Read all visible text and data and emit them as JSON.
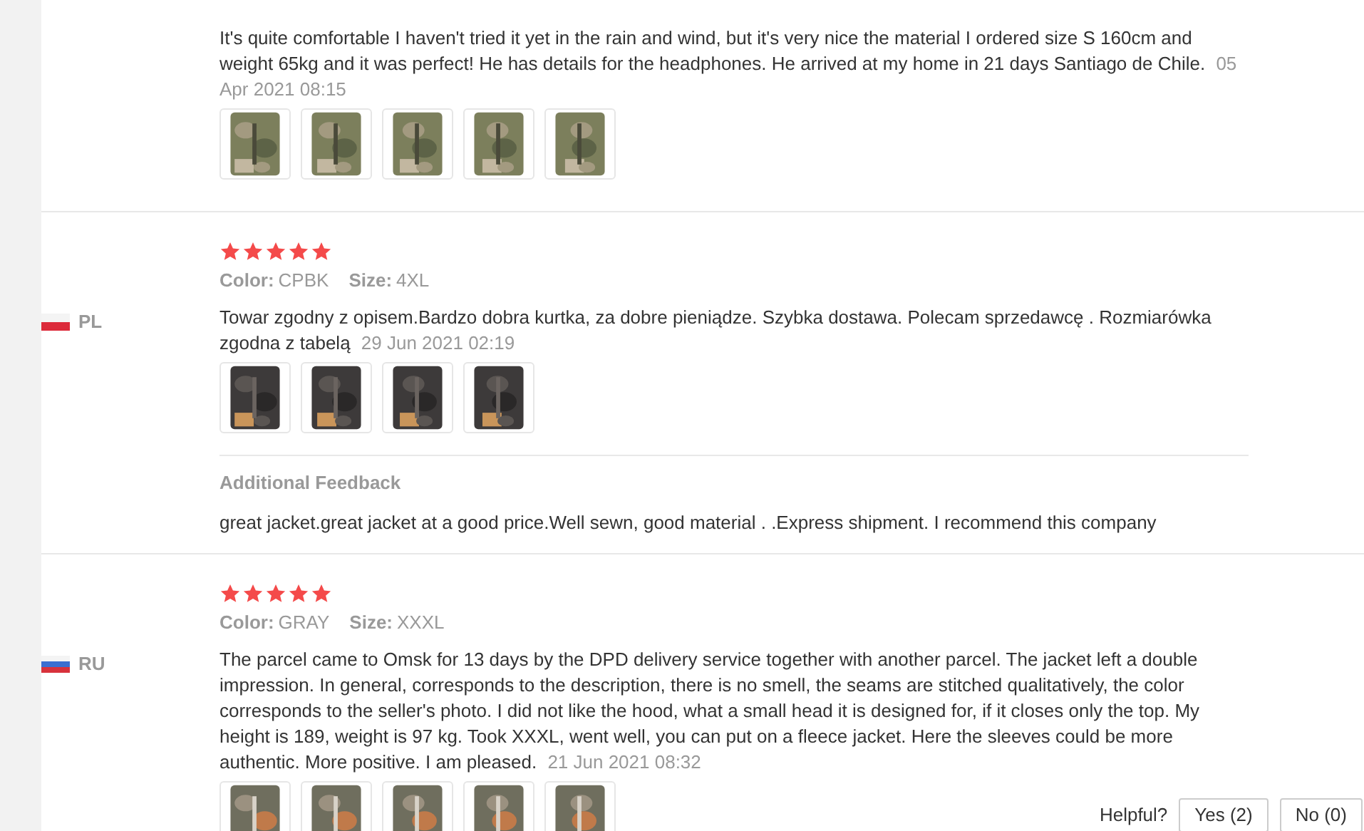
{
  "reviews": [
    {
      "text": "It's quite comfortable I haven't tried it yet in the rain and wind, but it's very nice the material I ordered size S 160cm and weight 65kg and it was perfect! He has details for the headphones. He arrived at my home in 21 days Santiago de Chile.",
      "date": "05 Apr 2021 08:15",
      "photos": [
        {
          "kind": "picture"
        },
        {
          "kind": "picture"
        },
        {
          "kind": "picture"
        },
        {
          "kind": "picture"
        },
        {
          "kind": "picture"
        }
      ]
    },
    {
      "country": {
        "code": "PL",
        "kind": "pl"
      },
      "stars": 5,
      "color_label": "Color:",
      "color_value": "CPBK",
      "size_label": "Size:",
      "size": "4XL",
      "text": "Towar zgodny z opisem.Bardzo dobra kurtka, za dobre pieniądze. Szybka dostawa. Polecam sprzedawcę . Rozmiarówka zgodna z tabelą",
      "date": "29 Jun 2021 02:19",
      "photos": [
        {
          "kind": "picture"
        },
        {
          "kind": "picture"
        },
        {
          "kind": "picture"
        },
        {
          "kind": "picture"
        }
      ],
      "additional": {
        "heading": "Additional Feedback",
        "text": "great jacket.great jacket at a good price.Well sewn, good material . .Express shipment. I recommend this company"
      }
    },
    {
      "country": {
        "code": "RU",
        "kind": "ru"
      },
      "stars": 5,
      "color_label": "Color:",
      "color_value": "GRAY",
      "size_label": "Size:",
      "size": "XXXL",
      "text": "The parcel came to Omsk for 13 days by the DPD delivery service together with another parcel. The jacket left a double impression. In general, corresponds to the description, there is no smell, the seams are stitched qualitatively, the color corresponds to the seller's photo. I did not like the hood, what a small head it is designed for, if it closes only the top. My height is 189, weight is 97 kg. Took XXXL, went well, you can put on a fleece jacket. Here the sleeves could be more authentic. More positive. I am pleased.",
      "date": "21 Jun 2021 08:32",
      "photos": [
        {
          "kind": "picture"
        },
        {
          "kind": "picture"
        },
        {
          "kind": "picture"
        },
        {
          "kind": "picture"
        },
        {
          "kind": "picture"
        }
      ],
      "helpful": {
        "label": "Helpful?",
        "yes": "Yes (2)",
        "no": "No (0)"
      }
    }
  ]
}
